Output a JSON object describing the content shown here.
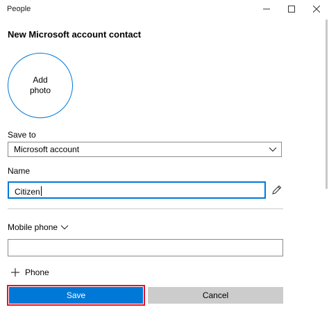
{
  "window": {
    "title": "People"
  },
  "form": {
    "heading": "New Microsoft account contact",
    "photo": {
      "line1": "Add",
      "line2": "photo"
    },
    "save_to": {
      "label": "Save to",
      "selected": "Microsoft account"
    },
    "name": {
      "label": "Name",
      "value": "Citizen"
    },
    "phone": {
      "type_label": "Mobile phone",
      "value": "",
      "add_label": "Phone"
    }
  },
  "actions": {
    "save_label": "Save",
    "cancel_label": "Cancel"
  },
  "colors": {
    "accent": "#0078d7",
    "highlight": "#e81123",
    "cancel_bg": "#cccccc"
  },
  "icons": {
    "minimize": "minimize-icon",
    "maximize": "maximize-icon",
    "close": "close-icon",
    "dropdown": "chevron-down-icon",
    "edit": "pencil-icon",
    "add": "plus-icon"
  }
}
